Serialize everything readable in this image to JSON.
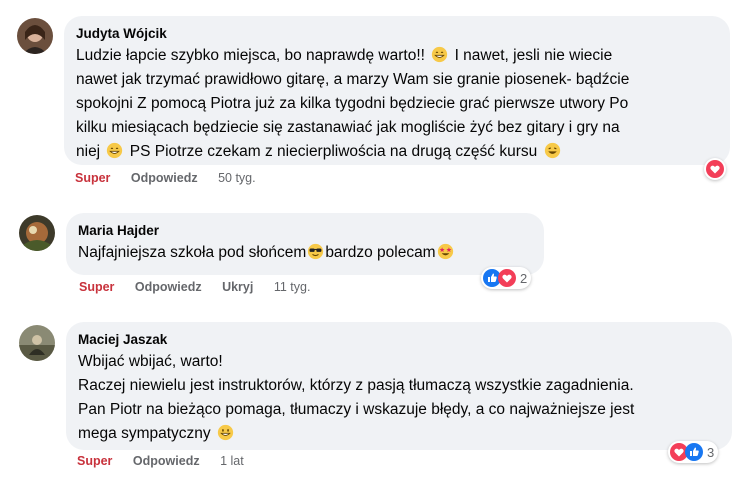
{
  "comments": [
    {
      "author": "Judyta Wójcik",
      "lines": [
        "Ludzie łapcie szybko miejsca, bo naprawdę warto!!",
        "I nawet, jesli nie wiecie",
        "nawet jak trzymać prawidłowo gitarę, a marzy Wam sie granie piosenek- bądźcie",
        "spokojni Z pomocą Piotra już za kilka tygodni będziecie grać pierwsze utwory Po",
        "kilku miesiącach będziecie się zastanawiać jak mogliście żyć bez gitary i gry na",
        "niej",
        "PS Piotrze czekam z niecierpliwościa na drugą część kursu"
      ],
      "actions": {
        "like": "Super",
        "reply": "Odpowiedz",
        "time": "50 tyg."
      },
      "reactions": {
        "icons": [
          "love-icon"
        ]
      }
    },
    {
      "author": "Maria Hajder",
      "lines": [
        "Najfajniejsza szkoła pod słońcem",
        "bardzo polecam"
      ],
      "actions": {
        "like": "Super",
        "reply": "Odpowiedz",
        "hide": "Ukryj",
        "time": "11 tyg."
      },
      "reactions": {
        "icons": [
          "like-icon",
          "love-icon"
        ],
        "count": "2"
      }
    },
    {
      "author": "Maciej Jaszak",
      "lines": [
        "Wbijać wbijać, warto!",
        "Raczej niewielu jest instruktorów, którzy z pasją tłumaczą wszystkie zagadnienia.",
        "Pan Piotr na bieżąco pomaga, tłumaczy i wskazuje błędy, a co najważniejsze jest",
        "mega sympatyczny"
      ],
      "actions": {
        "like": "Super",
        "reply": "Odpowiedz",
        "time": "1 lat"
      },
      "reactions": {
        "icons": [
          "love-icon",
          "like-icon"
        ],
        "count": "3"
      }
    }
  ],
  "colors": {
    "bubble": "#f0f2f5",
    "super": "#c8323c",
    "muted": "#65676b",
    "like": "#1877f2",
    "love": "#f33e58"
  }
}
